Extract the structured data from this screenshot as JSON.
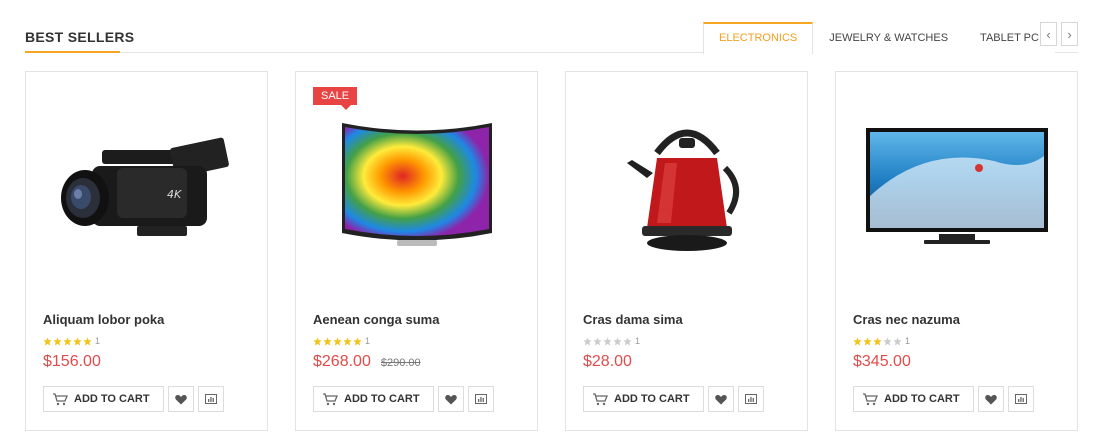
{
  "section": {
    "title": "Best Sellers"
  },
  "tabs": [
    {
      "label": "Electronics"
    },
    {
      "label": "Jewelry & Watches"
    },
    {
      "label": "Tablet PC"
    }
  ],
  "nav": {
    "prev": "‹",
    "next": "›"
  },
  "colors": {
    "accent": "#f5a623",
    "price": "#e14b4b",
    "sale": "#e84444",
    "star": "#f0c419",
    "star_empty": "#cccccc"
  },
  "products": [
    {
      "name": "Aliquam lobor poka",
      "rating": 5,
      "rating_count": "1",
      "price": "$156.00",
      "old_price": "",
      "sale_badge": "",
      "add_to_cart": "Add to Cart",
      "image": "camcorder"
    },
    {
      "name": "Aenean conga suma",
      "rating": 5,
      "rating_count": "1",
      "price": "$268.00",
      "old_price": "$290.00",
      "sale_badge": "Sale",
      "add_to_cart": "Add to Cart",
      "image": "curved-tv"
    },
    {
      "name": "Cras dama sima",
      "rating": 0,
      "rating_count": "1",
      "price": "$28.00",
      "old_price": "",
      "sale_badge": "",
      "add_to_cart": "Add to Cart",
      "image": "kettle"
    },
    {
      "name": "Cras nec nazuma",
      "rating": 3,
      "rating_count": "1",
      "price": "$345.00",
      "old_price": "",
      "sale_badge": "",
      "add_to_cart": "Add to Cart",
      "image": "flat-tv"
    }
  ]
}
